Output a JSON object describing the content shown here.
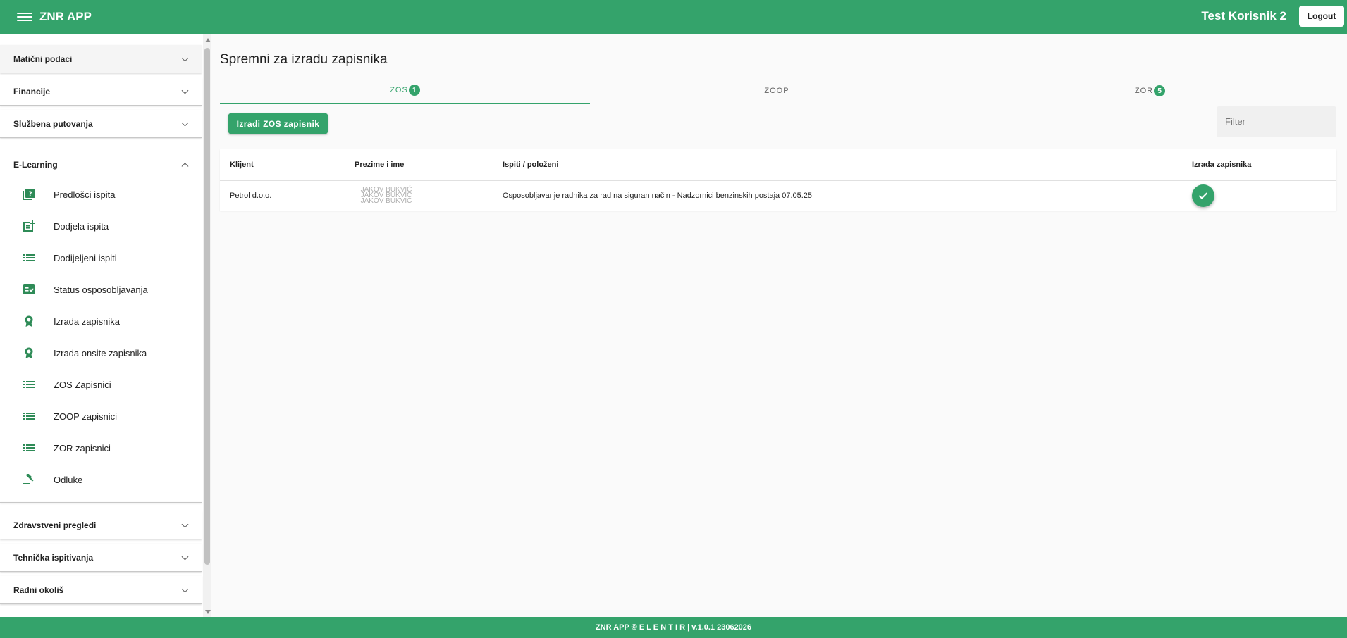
{
  "app": {
    "title": "ZNR APP"
  },
  "header": {
    "user_name": "Test Korisnik 2",
    "logout_label": "Logout"
  },
  "sidebar": {
    "panels": [
      {
        "label": "Matični podaci",
        "expanded": false
      },
      {
        "label": "Financije",
        "expanded": false
      },
      {
        "label": "Službena putovanja",
        "expanded": false
      },
      {
        "label": "E-Learning",
        "expanded": true
      },
      {
        "label": "Zdravstveni pregledi",
        "expanded": false
      },
      {
        "label": "Tehnička ispitivanja",
        "expanded": false
      },
      {
        "label": "Radni okoliš",
        "expanded": false
      }
    ],
    "elearning_items": [
      {
        "label": "Predlošci ispita",
        "icon": "quiz-icon"
      },
      {
        "label": "Dodjela ispita",
        "icon": "post-add-icon"
      },
      {
        "label": "Dodijeljeni ispiti",
        "icon": "list-icon"
      },
      {
        "label": "Status osposobljavanja",
        "icon": "fact-check-icon"
      },
      {
        "label": "Izrada zapisnika",
        "icon": "award-icon"
      },
      {
        "label": "Izrada onsite zapisnika",
        "icon": "award-icon"
      },
      {
        "label": "ZOS Zapisnici",
        "icon": "list-icon"
      },
      {
        "label": "ZOOP zapisnici",
        "icon": "list-icon"
      },
      {
        "label": "ZOR zapisnici",
        "icon": "list-icon"
      },
      {
        "label": "Odluke",
        "icon": "gavel-icon"
      }
    ]
  },
  "main": {
    "title": "Spremni za izradu zapisnika",
    "tabs": [
      {
        "label": "ZOS",
        "badge": "1",
        "active": true
      },
      {
        "label": "ZOOP",
        "badge": "",
        "active": false
      },
      {
        "label": "ZOR",
        "badge": "5",
        "active": false
      }
    ],
    "create_button_label": "Izradi ZOS zapisnik",
    "filter_placeholder": "Filter",
    "table": {
      "headers": [
        "Klijent",
        "Prezime i ime",
        "Ispiti / položeni",
        "Izrada zapisnika"
      ],
      "rows": [
        {
          "client": "Petrol d.o.o.",
          "name_lines": [
            "JAKOV BUKVIĆ",
            "JAKOV BUKVIĆ",
            "JAKOV BUKVIĆ"
          ],
          "exam": "Osposobljavanje radnika za rad na siguran način - Nadzornici benzinskih postaja 07.05.25",
          "action_icon": "check-icon"
        }
      ]
    }
  },
  "footer": {
    "text": "ZNR APP © E L E N T I R | v.1.0.1 23062026"
  },
  "colors": {
    "brand": "#34a36b",
    "background": "#fafafa"
  }
}
